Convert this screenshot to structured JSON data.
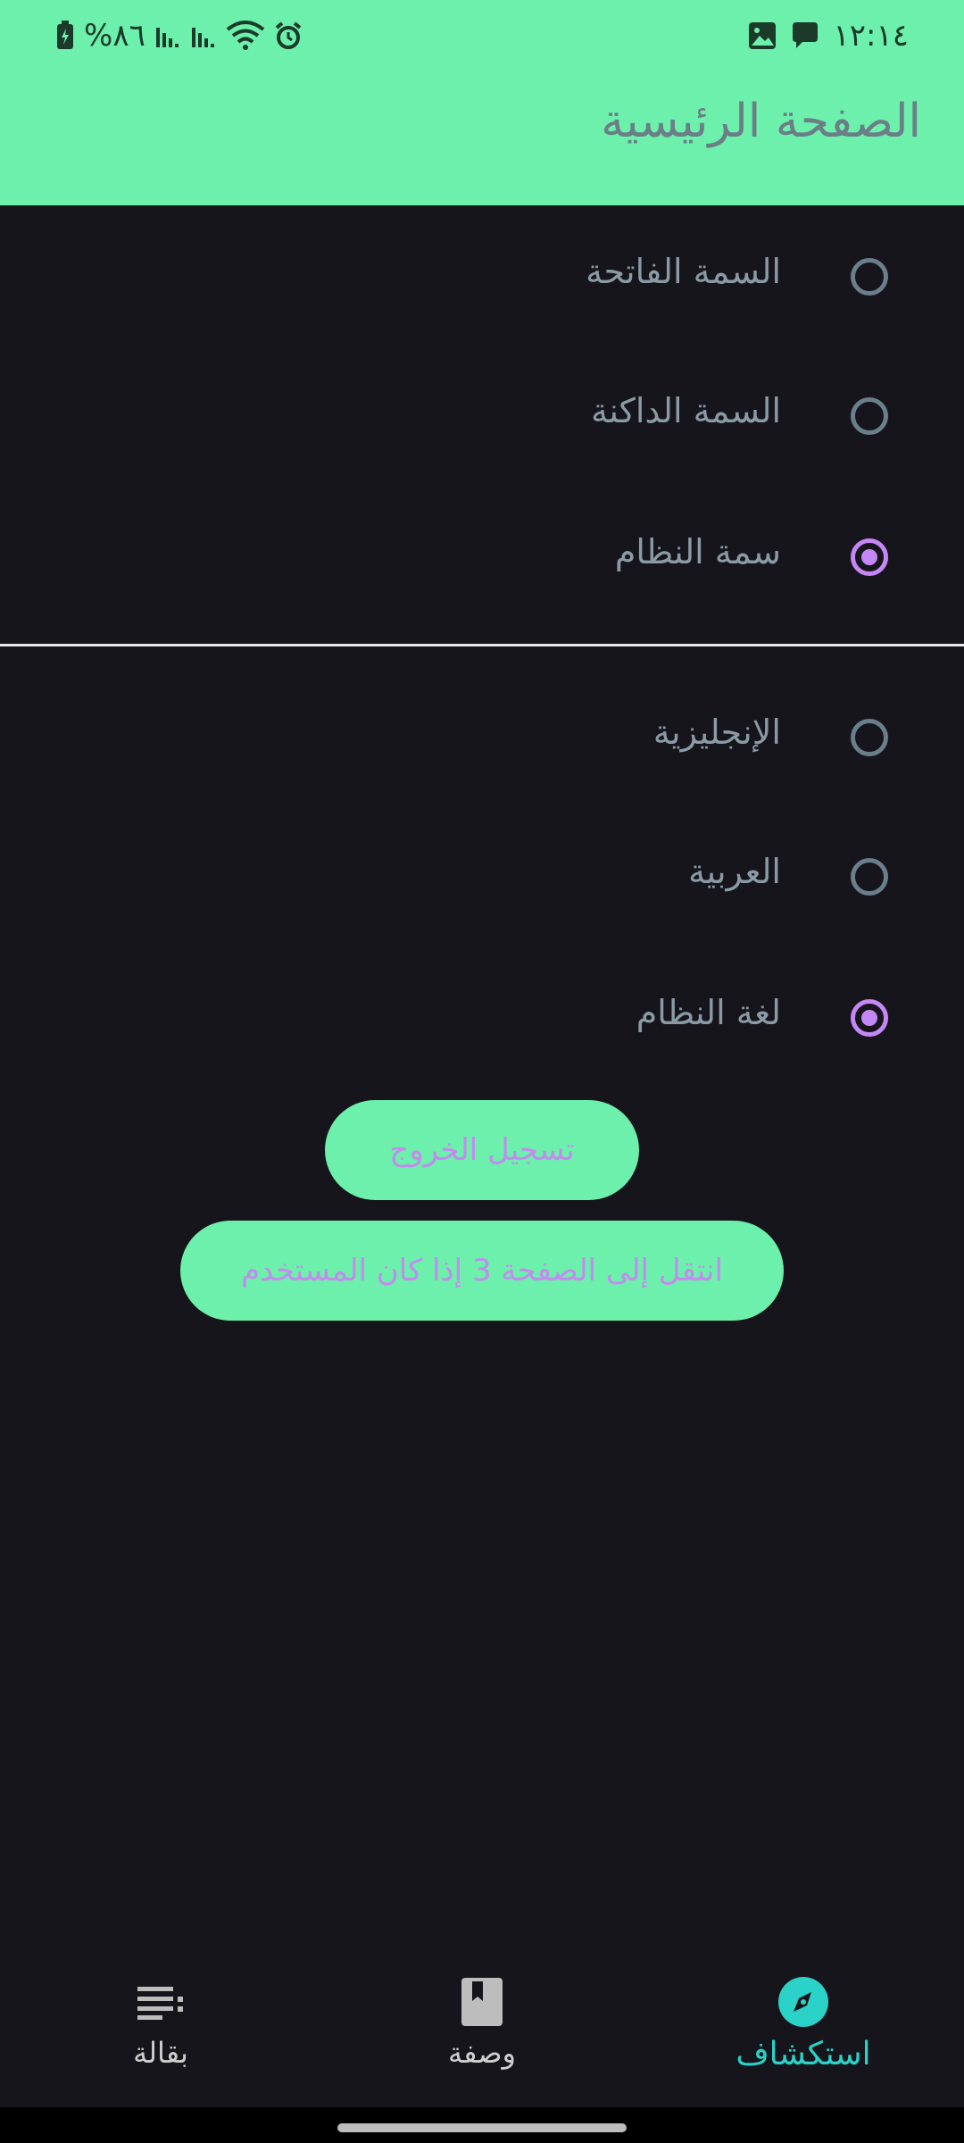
{
  "status_bar": {
    "time": "١٢:١٤",
    "battery_text": "%٨٦",
    "icons_left": [
      "battery-charging-icon",
      "signal-icon",
      "signal-icon",
      "wifi-icon",
      "alarm-icon"
    ],
    "icons_right": [
      "image-icon",
      "chat-icon"
    ]
  },
  "app_bar": {
    "title": "الصفحة الرئيسية"
  },
  "theme_options": [
    {
      "label": "السمة الفاتحة",
      "selected": false
    },
    {
      "label": "السمة الداكنة",
      "selected": false
    },
    {
      "label": "سمة النظام",
      "selected": true
    }
  ],
  "language_options": [
    {
      "label": "الإنجليزية",
      "selected": false
    },
    {
      "label": "العربية",
      "selected": false
    },
    {
      "label": "لغة النظام",
      "selected": true
    }
  ],
  "buttons": {
    "logout": "تسجيل الخروج",
    "goto_page3": "انتقل إلى الصفحة 3 إذا كان المستخدم"
  },
  "bottom_nav": {
    "items": [
      {
        "label": "بقالة",
        "icon": "list-icon",
        "active": false
      },
      {
        "label": "وصفة",
        "icon": "book-icon",
        "active": false
      },
      {
        "label": "استكشاف",
        "icon": "compass-icon",
        "active": true
      }
    ]
  },
  "colors": {
    "accent_green": "#6cf0ab",
    "background": "#17151c",
    "radio_checked": "#c587f5",
    "active_nav": "#2bd2c7"
  }
}
